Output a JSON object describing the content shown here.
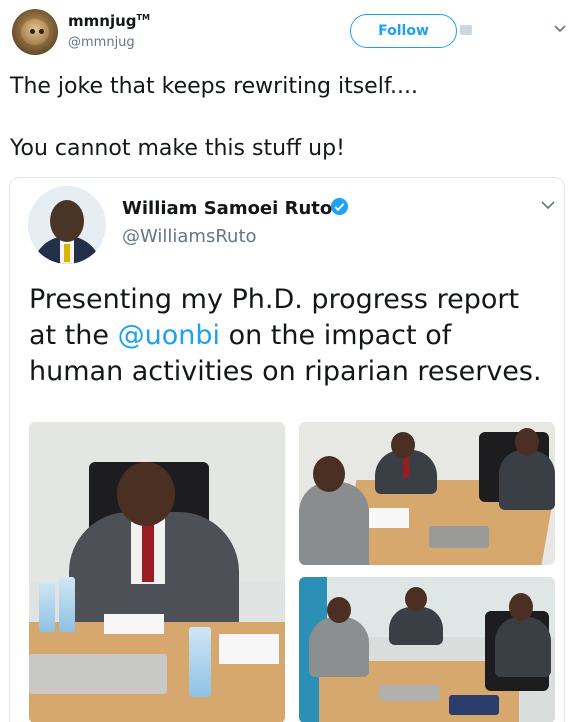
{
  "tweet": {
    "author": {
      "display_name": "mmnjug",
      "badge": "TM",
      "handle": "@mmnjug"
    },
    "follow_label": "Follow",
    "text_line1": "The joke that keeps rewriting itself....",
    "text_line2": "You cannot make this stuff up!"
  },
  "quoted": {
    "display_name": "William Samoei Ruto",
    "handle": "@WilliamsRuto",
    "text": {
      "l1": "Presenting my Ph.D. progress report",
      "l2_pre": "at the ",
      "l2_mention": "@uonbi",
      "l2_post": " on the impact of",
      "l3": "human activities on riparian reserves."
    },
    "photos": [
      "meeting-photo-1",
      "meeting-photo-2",
      "meeting-photo-3"
    ]
  },
  "colors": {
    "accent": "#1da1f2",
    "text": "#14171a",
    "muted": "#657786",
    "border": "#e1e8ed"
  },
  "icons": {
    "caret": "chevron-down-icon",
    "verified": "verified-badge-icon"
  }
}
